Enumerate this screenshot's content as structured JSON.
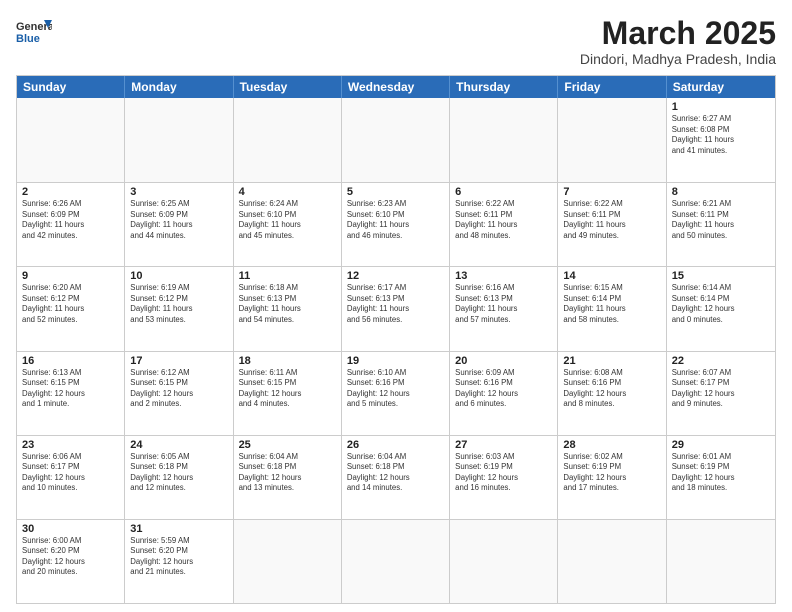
{
  "header": {
    "logo_general": "General",
    "logo_blue": "Blue",
    "title": "March 2025",
    "subtitle": "Dindori, Madhya Pradesh, India"
  },
  "weekdays": [
    "Sunday",
    "Monday",
    "Tuesday",
    "Wednesday",
    "Thursday",
    "Friday",
    "Saturday"
  ],
  "rows": [
    [
      {
        "day": "",
        "info": ""
      },
      {
        "day": "",
        "info": ""
      },
      {
        "day": "",
        "info": ""
      },
      {
        "day": "",
        "info": ""
      },
      {
        "day": "",
        "info": ""
      },
      {
        "day": "",
        "info": ""
      },
      {
        "day": "1",
        "info": "Sunrise: 6:27 AM\nSunset: 6:08 PM\nDaylight: 11 hours\nand 41 minutes."
      }
    ],
    [
      {
        "day": "2",
        "info": "Sunrise: 6:26 AM\nSunset: 6:09 PM\nDaylight: 11 hours\nand 42 minutes."
      },
      {
        "day": "3",
        "info": "Sunrise: 6:25 AM\nSunset: 6:09 PM\nDaylight: 11 hours\nand 44 minutes."
      },
      {
        "day": "4",
        "info": "Sunrise: 6:24 AM\nSunset: 6:10 PM\nDaylight: 11 hours\nand 45 minutes."
      },
      {
        "day": "5",
        "info": "Sunrise: 6:23 AM\nSunset: 6:10 PM\nDaylight: 11 hours\nand 46 minutes."
      },
      {
        "day": "6",
        "info": "Sunrise: 6:22 AM\nSunset: 6:11 PM\nDaylight: 11 hours\nand 48 minutes."
      },
      {
        "day": "7",
        "info": "Sunrise: 6:22 AM\nSunset: 6:11 PM\nDaylight: 11 hours\nand 49 minutes."
      },
      {
        "day": "8",
        "info": "Sunrise: 6:21 AM\nSunset: 6:11 PM\nDaylight: 11 hours\nand 50 minutes."
      }
    ],
    [
      {
        "day": "9",
        "info": "Sunrise: 6:20 AM\nSunset: 6:12 PM\nDaylight: 11 hours\nand 52 minutes."
      },
      {
        "day": "10",
        "info": "Sunrise: 6:19 AM\nSunset: 6:12 PM\nDaylight: 11 hours\nand 53 minutes."
      },
      {
        "day": "11",
        "info": "Sunrise: 6:18 AM\nSunset: 6:13 PM\nDaylight: 11 hours\nand 54 minutes."
      },
      {
        "day": "12",
        "info": "Sunrise: 6:17 AM\nSunset: 6:13 PM\nDaylight: 11 hours\nand 56 minutes."
      },
      {
        "day": "13",
        "info": "Sunrise: 6:16 AM\nSunset: 6:13 PM\nDaylight: 11 hours\nand 57 minutes."
      },
      {
        "day": "14",
        "info": "Sunrise: 6:15 AM\nSunset: 6:14 PM\nDaylight: 11 hours\nand 58 minutes."
      },
      {
        "day": "15",
        "info": "Sunrise: 6:14 AM\nSunset: 6:14 PM\nDaylight: 12 hours\nand 0 minutes."
      }
    ],
    [
      {
        "day": "16",
        "info": "Sunrise: 6:13 AM\nSunset: 6:15 PM\nDaylight: 12 hours\nand 1 minute."
      },
      {
        "day": "17",
        "info": "Sunrise: 6:12 AM\nSunset: 6:15 PM\nDaylight: 12 hours\nand 2 minutes."
      },
      {
        "day": "18",
        "info": "Sunrise: 6:11 AM\nSunset: 6:15 PM\nDaylight: 12 hours\nand 4 minutes."
      },
      {
        "day": "19",
        "info": "Sunrise: 6:10 AM\nSunset: 6:16 PM\nDaylight: 12 hours\nand 5 minutes."
      },
      {
        "day": "20",
        "info": "Sunrise: 6:09 AM\nSunset: 6:16 PM\nDaylight: 12 hours\nand 6 minutes."
      },
      {
        "day": "21",
        "info": "Sunrise: 6:08 AM\nSunset: 6:16 PM\nDaylight: 12 hours\nand 8 minutes."
      },
      {
        "day": "22",
        "info": "Sunrise: 6:07 AM\nSunset: 6:17 PM\nDaylight: 12 hours\nand 9 minutes."
      }
    ],
    [
      {
        "day": "23",
        "info": "Sunrise: 6:06 AM\nSunset: 6:17 PM\nDaylight: 12 hours\nand 10 minutes."
      },
      {
        "day": "24",
        "info": "Sunrise: 6:05 AM\nSunset: 6:18 PM\nDaylight: 12 hours\nand 12 minutes."
      },
      {
        "day": "25",
        "info": "Sunrise: 6:04 AM\nSunset: 6:18 PM\nDaylight: 12 hours\nand 13 minutes."
      },
      {
        "day": "26",
        "info": "Sunrise: 6:04 AM\nSunset: 6:18 PM\nDaylight: 12 hours\nand 14 minutes."
      },
      {
        "day": "27",
        "info": "Sunrise: 6:03 AM\nSunset: 6:19 PM\nDaylight: 12 hours\nand 16 minutes."
      },
      {
        "day": "28",
        "info": "Sunrise: 6:02 AM\nSunset: 6:19 PM\nDaylight: 12 hours\nand 17 minutes."
      },
      {
        "day": "29",
        "info": "Sunrise: 6:01 AM\nSunset: 6:19 PM\nDaylight: 12 hours\nand 18 minutes."
      }
    ],
    [
      {
        "day": "30",
        "info": "Sunrise: 6:00 AM\nSunset: 6:20 PM\nDaylight: 12 hours\nand 20 minutes."
      },
      {
        "day": "31",
        "info": "Sunrise: 5:59 AM\nSunset: 6:20 PM\nDaylight: 12 hours\nand 21 minutes."
      },
      {
        "day": "",
        "info": ""
      },
      {
        "day": "",
        "info": ""
      },
      {
        "day": "",
        "info": ""
      },
      {
        "day": "",
        "info": ""
      },
      {
        "day": "",
        "info": ""
      }
    ]
  ]
}
